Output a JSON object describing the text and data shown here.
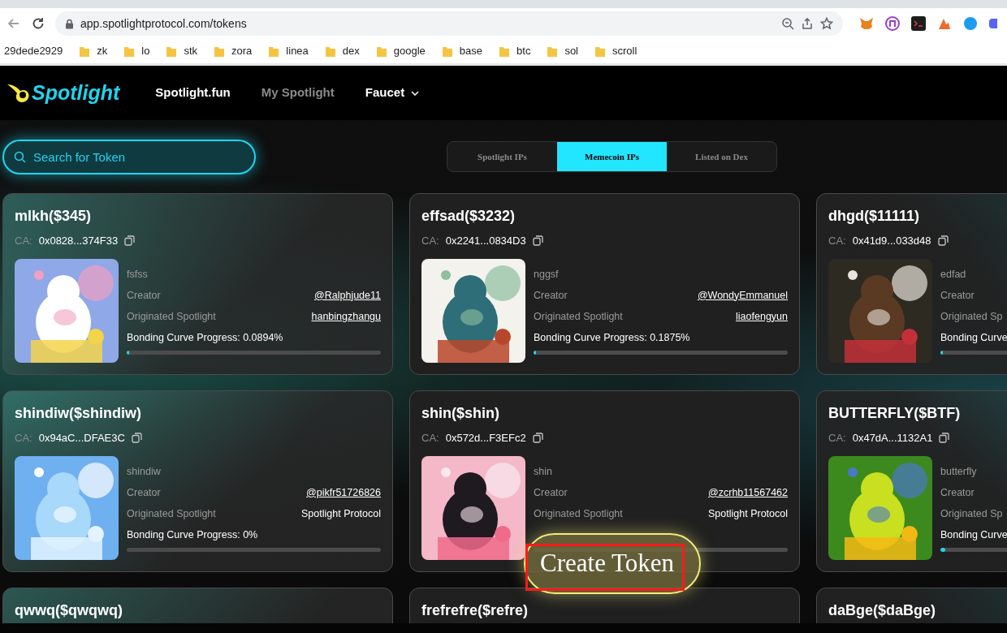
{
  "browser": {
    "url": "app.spotlightprotocol.com/tokens",
    "bookmarks": [
      {
        "label": "29dede2929",
        "kind": "link"
      },
      {
        "label": "zk",
        "kind": "folder"
      },
      {
        "label": "lo",
        "kind": "folder"
      },
      {
        "label": "stk",
        "kind": "folder"
      },
      {
        "label": "zora",
        "kind": "folder"
      },
      {
        "label": "linea",
        "kind": "folder"
      },
      {
        "label": "dex",
        "kind": "folder"
      },
      {
        "label": "google",
        "kind": "folder"
      },
      {
        "label": "base",
        "kind": "folder"
      },
      {
        "label": "btc",
        "kind": "folder"
      },
      {
        "label": "sol",
        "kind": "folder"
      },
      {
        "label": "scroll",
        "kind": "folder"
      }
    ]
  },
  "header": {
    "logo": "Spotlight",
    "nav": [
      {
        "label": "Spotlight.fun",
        "muted": false,
        "dropdown": false
      },
      {
        "label": "My Spotlight",
        "muted": true,
        "dropdown": false
      },
      {
        "label": "Faucet",
        "muted": false,
        "dropdown": true
      }
    ]
  },
  "search": {
    "placeholder": "Search for Token"
  },
  "tabs": [
    {
      "label": "Spotlight IPs",
      "selected": false
    },
    {
      "label": "Memecoin IPs",
      "selected": true
    },
    {
      "label": "Listed on Dex",
      "selected": false
    }
  ],
  "cards": [
    {
      "title": "mlkh($345)",
      "ca_label": "CA:",
      "ca": "0x0828...374F33",
      "description": "fsfss",
      "rows": [
        {
          "label": "Creator",
          "value": "@Ralphjude11",
          "kind": "link"
        },
        {
          "label": "Originated Spotlight",
          "value": "hanbingzhangu",
          "kind": "link"
        }
      ],
      "progress_label": "Bonding Curve Progress: 0.0894%",
      "level": 0.01
    },
    {
      "title": "effsad($3232)",
      "ca_label": "CA:",
      "ca": "0x2241...0834D3",
      "description": "nggsf",
      "rows": [
        {
          "label": "Creator",
          "value": "@WondyEmmanuel",
          "kind": "link"
        },
        {
          "label": "Originated Spotlight",
          "value": "liaofengyun",
          "kind": "link"
        }
      ],
      "progress_label": "Bonding Curve Progress: 0.1875%",
      "level": 0.01
    },
    {
      "title": "dhgd($11111)",
      "ca_label": "CA:",
      "ca": "0x41d9...033d48",
      "description": "edfad",
      "rows": [
        {
          "label": "Creator",
          "kind": "label"
        },
        {
          "label": "Originated Sp",
          "kind": "label"
        }
      ],
      "progress_label": "Bonding Curve",
      "level": 0.01
    },
    {
      "title": "shindiw($shindiw)",
      "ca_label": "CA:",
      "ca": "0x94aC...DFAE3C",
      "description": "shindiw",
      "rows": [
        {
          "label": "Creator",
          "value": "@pikfr51726826",
          "kind": "link"
        },
        {
          "label": "Originated Spotlight",
          "value": "Spotlight Protocol",
          "kind": "text"
        }
      ],
      "progress_label": "Bonding Curve Progress: 0%",
      "level": 0
    },
    {
      "title": "shin($shin)",
      "ca_label": "CA:",
      "ca": "0x572d...F3EFc2",
      "description": "shin",
      "rows": [
        {
          "label": "Creator",
          "value": "@zcrhb11567462",
          "kind": "link"
        },
        {
          "label": "Originated Spotlight",
          "value": "Spotlight Protocol",
          "kind": "text"
        }
      ],
      "level": 0
    },
    {
      "title": "BUTTERFLY($BTF)",
      "ca_label": "CA:",
      "ca": "0x47dA...1132A1",
      "description": "butterfly",
      "rows": [
        {
          "label": "Creator",
          "kind": "label"
        },
        {
          "label": "Originated Sp",
          "kind": "label"
        }
      ],
      "progress_label": "Bonding Curve",
      "level": 0.02
    },
    {
      "title": "qwwq($qwqwq)"
    },
    {
      "title": "frefrefre($refre)"
    },
    {
      "title": "daBge($daBge)"
    }
  ],
  "create_button": {
    "label": "Create Token",
    "highlighted": true
  }
}
